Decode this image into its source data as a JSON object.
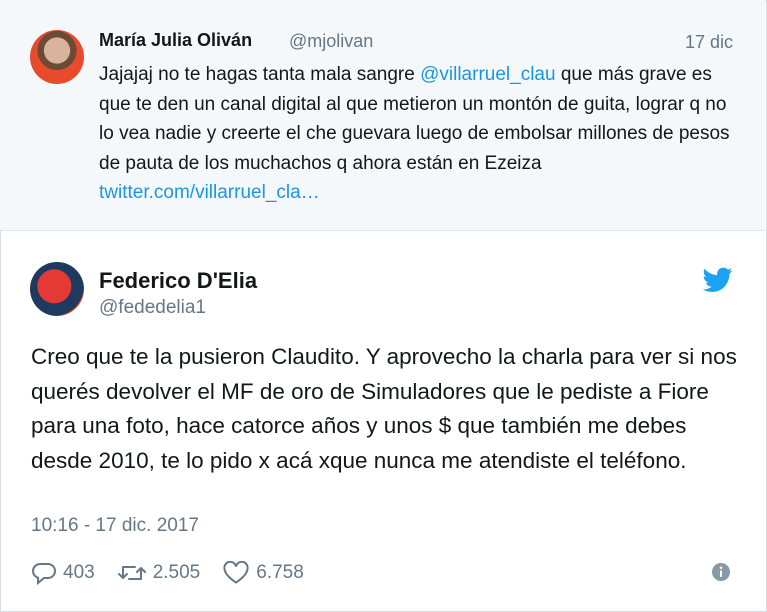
{
  "parent_tweet": {
    "author_name": "María Julia Oliván",
    "author_handle": "@mjolivan",
    "date": "17 dic",
    "text_before": "Jajajaj no te hagas tanta mala sangre ",
    "mention": "@villarruel_clau",
    "text_after": " que más grave es que te den un canal digital al que metieron un montón de guita, lograr q no lo vea nadie y creerte el che guevara luego de embolsar millones de pesos de pauta de los muchachos q ahora están en Ezeiza ",
    "link": "twitter.com/villarruel_cla…"
  },
  "main_tweet": {
    "author_name": "Federico D'Elia",
    "author_handle": "@fededelia1",
    "text": "Creo que te la pusieron Claudito. Y aprovecho la charla para ver si nos querés devolver el MF de oro de Simuladores que le pediste a Fiore para una foto, hace catorce años y unos $ que también me debes desde 2010, te lo pido x acá xque nunca me atendiste el teléfono.",
    "timestamp": "10:16 - 17 dic. 2017",
    "replies": "403",
    "retweets": "2.505",
    "likes": "6.758"
  },
  "icons": [
    "twitter-bird-icon",
    "reply-icon",
    "retweet-icon",
    "heart-icon",
    "info-icon"
  ],
  "colors": {
    "link": "#1b95e0",
    "twitter_blue": "#1da1f2",
    "muted": "#657786",
    "parent_bg": "#f5f8fa"
  }
}
